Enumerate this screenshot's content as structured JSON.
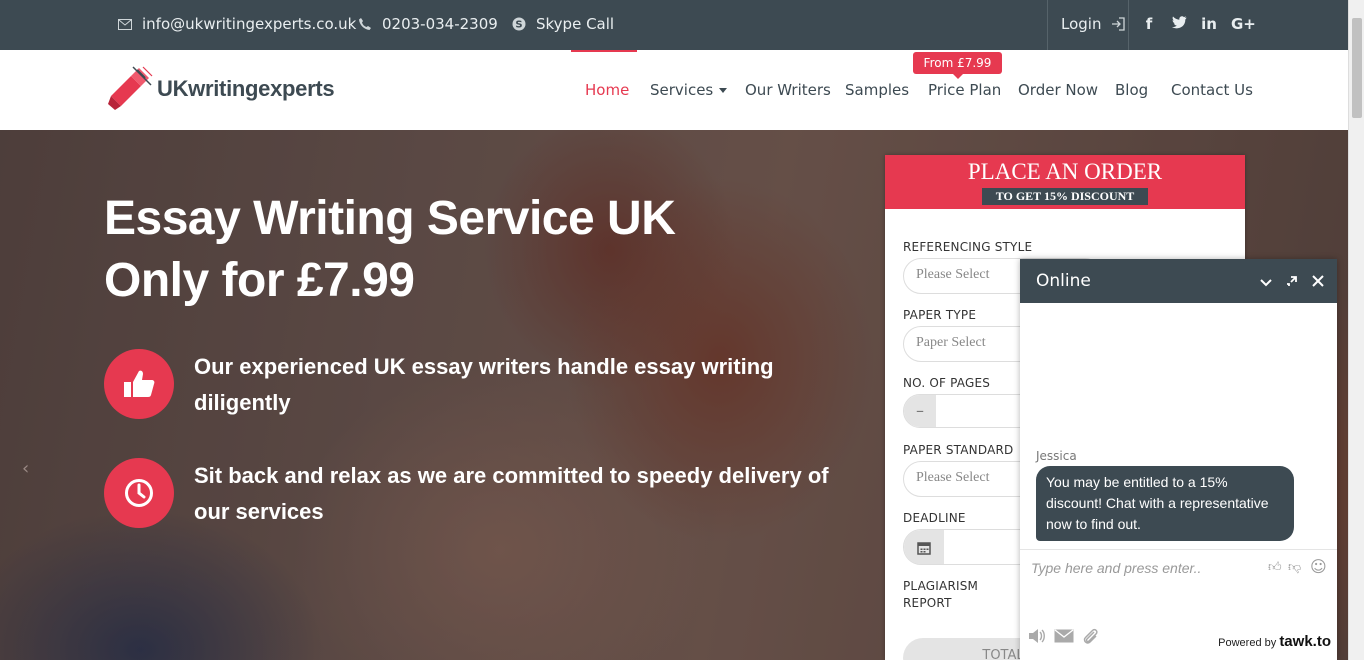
{
  "topbar": {
    "email": "info@ukwritingexperts.co.uk",
    "phone": "0203-034-2309",
    "skype": "Skype Call",
    "login": "Login",
    "social": {
      "facebook": "f",
      "twitter": "t",
      "linkedin": "in",
      "googleplus": "G+"
    }
  },
  "brand": {
    "logo_text": "UKwritingexperts"
  },
  "nav": {
    "items": [
      {
        "label": "Home",
        "active": true
      },
      {
        "label": "Services",
        "dropdown": true
      },
      {
        "label": "Our Writers"
      },
      {
        "label": "Samples"
      },
      {
        "label": "Price Plan"
      },
      {
        "label": "Order Now"
      },
      {
        "label": "Blog"
      },
      {
        "label": "Contact Us"
      }
    ],
    "price_badge": "From £7.99"
  },
  "hero": {
    "title_line1": "Essay Writing Service UK",
    "title_line2": "Only for £7.99",
    "features": [
      {
        "icon": "thumbs-up-icon",
        "text": "Our experienced UK essay writers handle essay writing diligently"
      },
      {
        "icon": "clock-icon",
        "text": "Sit back and relax as we are committed to speedy delivery of our services"
      }
    ]
  },
  "order_form": {
    "title": "PLACE AN ORDER",
    "subtitle": "TO GET 15% DISCOUNT",
    "referencing_label": "REFERENCING STYLE",
    "referencing_value": "Please Select",
    "paper_type_label": "PAPER TYPE",
    "paper_type_value": "Paper Select",
    "pages_label": "NO. OF PAGES",
    "pages_minus": "–",
    "standard_label": "PAPER STANDARD",
    "standard_value": "Please Select",
    "deadline_label": "DEADLINE",
    "plagiarism_label_1": "PLAGIARISM",
    "plagiarism_label_2": "REPORT",
    "total_label": "TOTAL"
  },
  "chat": {
    "status": "Online",
    "agent_name": "Jessica",
    "message": "You may be entitled to a 15% discount! Chat with a representative now to find out.",
    "input_placeholder": "Type here and press enter..",
    "powered_by": "Powered by",
    "brand": "tawk.to"
  },
  "colors": {
    "accent": "#e63950",
    "dark": "#3d4a52"
  }
}
